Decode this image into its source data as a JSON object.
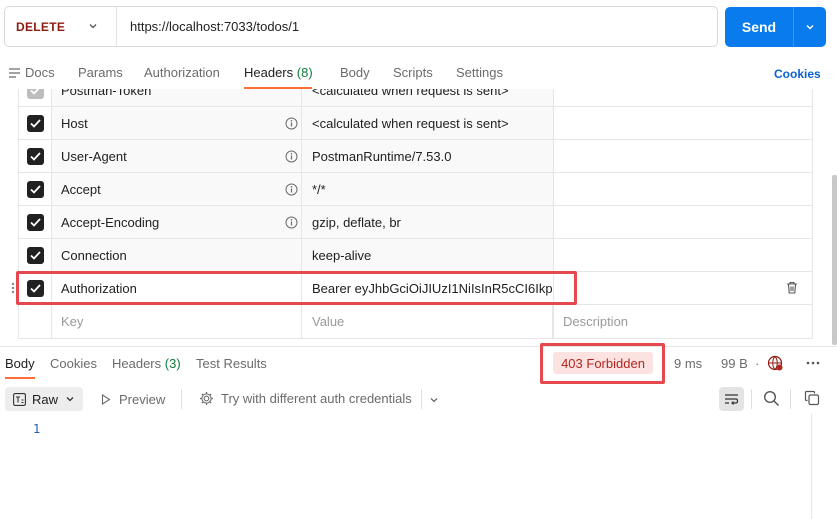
{
  "request": {
    "method": "DELETE",
    "url": "https://localhost:7033/todos/1",
    "send_label": "Send"
  },
  "request_tabs": [
    {
      "label": "Docs"
    },
    {
      "label": "Params"
    },
    {
      "label": "Authorization"
    },
    {
      "label": "Headers",
      "count": "(8)"
    },
    {
      "label": "Body"
    },
    {
      "label": "Scripts"
    },
    {
      "label": "Settings"
    }
  ],
  "cookies_label": "Cookies",
  "headers": {
    "rows": [
      {
        "key": "Postman-Token",
        "value": "<calculated when request is sent>"
      },
      {
        "key": "Host",
        "value": "<calculated when request is sent>"
      },
      {
        "key": "User-Agent",
        "value": "PostmanRuntime/7.53.0"
      },
      {
        "key": "Accept",
        "value": "*/*"
      },
      {
        "key": "Accept-Encoding",
        "value": "gzip, deflate, br"
      },
      {
        "key": "Connection",
        "value": "keep-alive"
      },
      {
        "key": "Authorization",
        "value": "Bearer eyJhbGciOiJIUzI1NiIsInR5cCI6Ikp..."
      }
    ],
    "placeholders": {
      "key": "Key",
      "value": "Value",
      "description": "Description"
    }
  },
  "response_tabs": [
    {
      "label": "Body"
    },
    {
      "label": "Cookies"
    },
    {
      "label": "Headers",
      "count": "(3)"
    },
    {
      "label": "Test Results"
    }
  ],
  "response_status": {
    "status": "403 Forbidden",
    "time": "9 ms",
    "size": "99 B",
    "status_color": "#b3261e"
  },
  "response_toolbar": {
    "format": "Raw",
    "preview": "Preview",
    "try_auth": "Try with different auth credentials"
  },
  "editor": {
    "line_number": "1"
  },
  "colors": {
    "accent": "#ff6c37",
    "send": "#097bed",
    "method": "#8e1a10",
    "highlight": "#e5484d"
  }
}
